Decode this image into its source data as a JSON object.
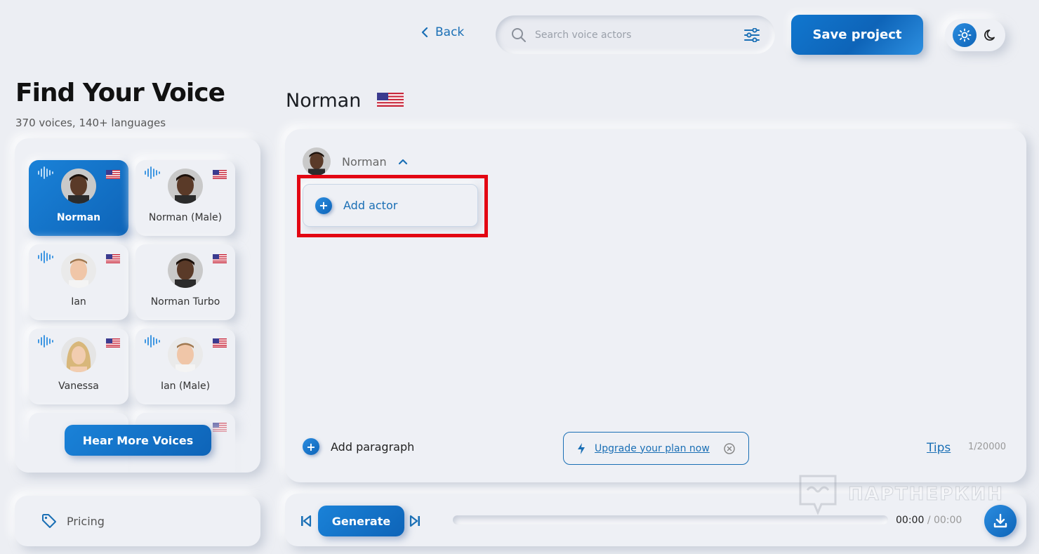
{
  "header": {
    "back_label": "Back",
    "search_placeholder": "Search voice actors",
    "save_label": "Save project"
  },
  "sidebar": {
    "title": "Find Your Voice",
    "subtitle": "370 voices, 140+ languages",
    "voices": [
      {
        "name": "Norman",
        "selected": true
      },
      {
        "name": "Norman (Male)",
        "selected": false
      },
      {
        "name": "Ian",
        "selected": false
      },
      {
        "name": "Norman Turbo",
        "selected": false
      },
      {
        "name": "Vanessa",
        "selected": false
      },
      {
        "name": "Ian (Male)",
        "selected": false
      }
    ],
    "hear_more_label": "Hear More Voices",
    "pricing_label": "Pricing"
  },
  "main": {
    "actor_name": "Norman",
    "selected_actor_label": "Norman",
    "add_actor_label": "Add actor",
    "add_paragraph_label": "Add paragraph",
    "upgrade_label": "Upgrade your plan now",
    "tips_label": "Tips",
    "char_counter": "1/20000"
  },
  "player": {
    "generate_label": "Generate",
    "current_time": "00:00",
    "total_time": "/ 00:00",
    "progress": 0
  },
  "watermark": "ПАРТНЕРКИН",
  "colors": {
    "accent": "#0e64b8",
    "background": "#eceef3",
    "highlight_box": "#e30613"
  }
}
